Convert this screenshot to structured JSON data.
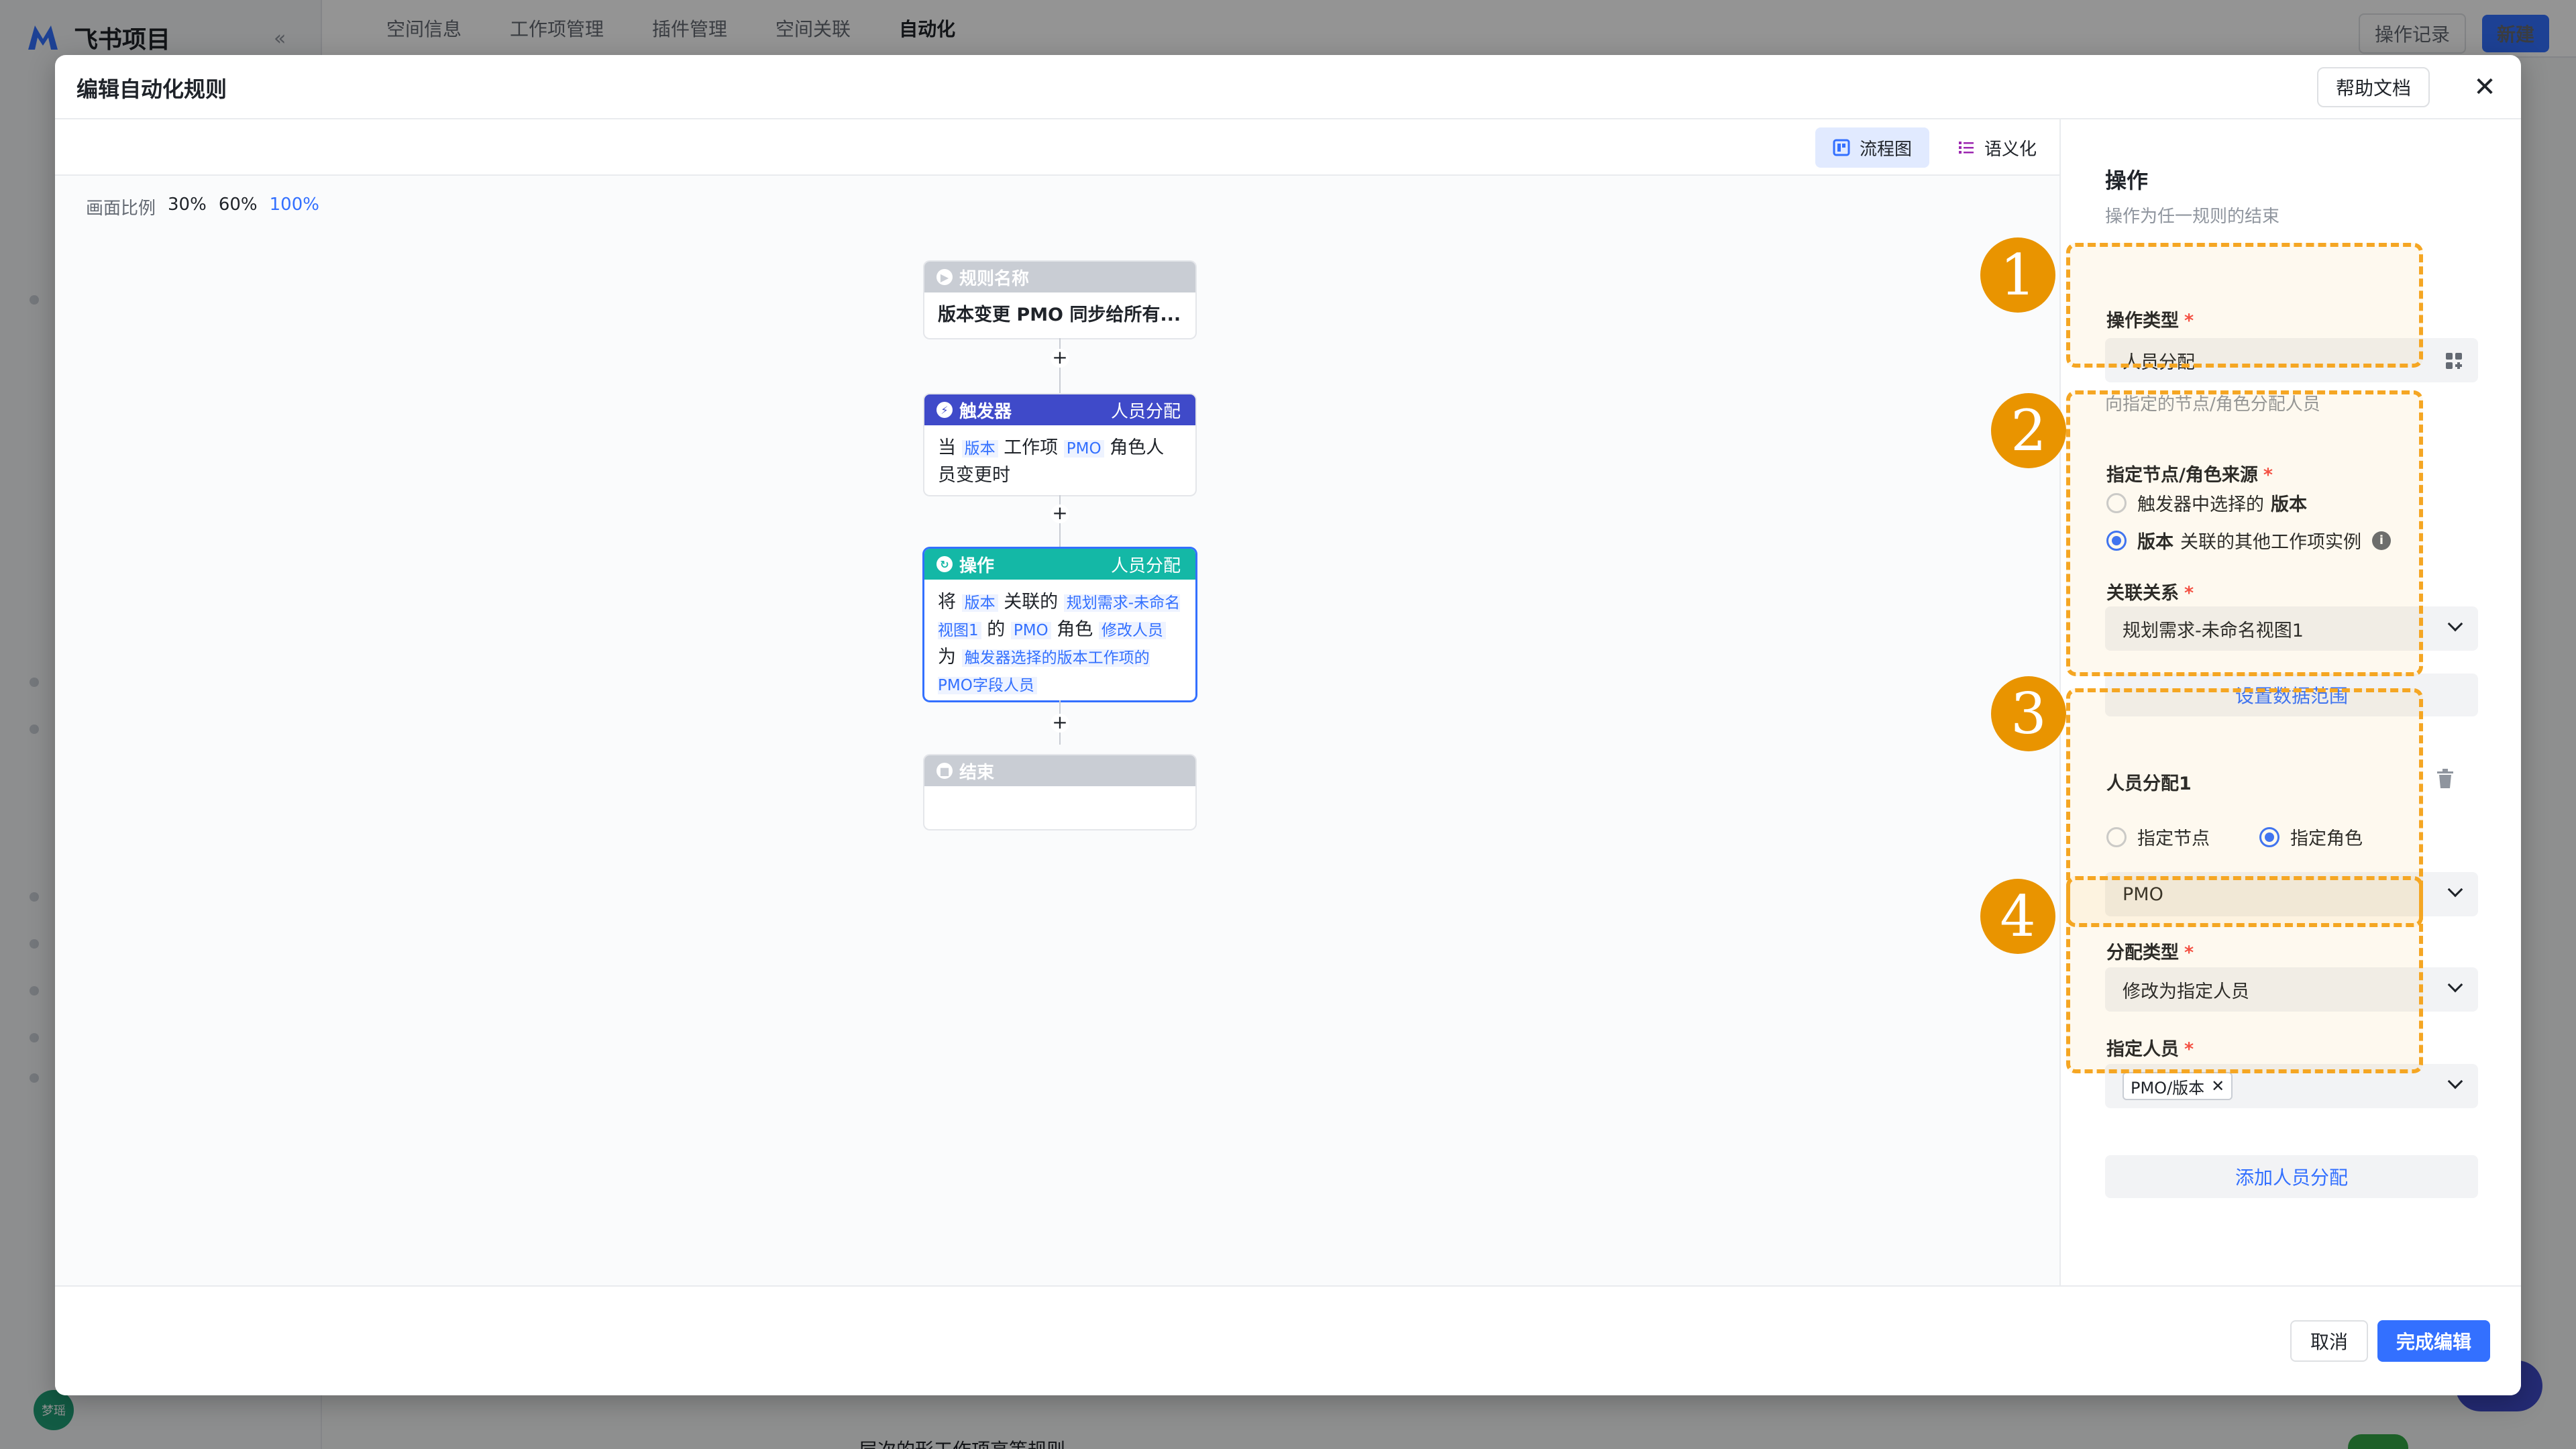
{
  "background": {
    "app_name": "飞书项目",
    "nav_tabs": [
      "空间信息",
      "工作项管理",
      "插件管理",
      "空间关联",
      "自动化"
    ],
    "oplog_label": "操作记录",
    "new_label": "新建",
    "avatar_text": "梦瑶",
    "bottom_text": "层次的形工作项高等规则"
  },
  "modal": {
    "title": "编辑自动化规则",
    "help_label": "帮助文档",
    "close_icon": "close-icon",
    "view_flow_label": "流程图",
    "view_semantic_label": "语义化",
    "zoom_label": "画面比例",
    "zoom_options": [
      "30%",
      "60%",
      "100%"
    ],
    "zoom_active": "100%"
  },
  "flow": {
    "rule_node": {
      "head": "规则名称",
      "body": "版本变更 PMO 同步给所有..."
    },
    "trigger_node": {
      "head": "触发器",
      "sub": "人员分配",
      "b1": "当",
      "t1": "版本",
      "b2": "工作项",
      "t2": "PMO",
      "b3": "角色人员变更时"
    },
    "action_node": {
      "head": "操作",
      "sub": "人员分配",
      "b1": "将",
      "t1": "版本",
      "b2": "关联的",
      "t2": "规划需求-未命名视图1",
      "b3": "的",
      "t3": "PMO",
      "b4": "角色",
      "t4": "修改人员",
      "b5": "为",
      "t5": "触发器选择的版本工作项的PMO字段人员"
    },
    "end_node": {
      "head": "结束"
    }
  },
  "panel": {
    "title": "操作",
    "desc": "操作为任一规则的结束",
    "op_type_label": "操作类型",
    "op_type_value": "人员分配",
    "op_type_hint": "向指定的节点/角色分配人员",
    "source_label": "指定节点/角色来源",
    "source_opt1_a": "触发器中选择的",
    "source_opt1_b": "版本",
    "source_opt2_a": "版本",
    "source_opt2_b": "关联的其他工作项实例",
    "relation_label": "关联关系",
    "relation_value": "规划需求-未命名视图1",
    "set_range_label": "设置数据范围",
    "assign_title": "人员分配1",
    "assign_opt_node": "指定节点",
    "assign_opt_role": "指定角色",
    "role_value": "PMO",
    "assign_type_label": "分配类型",
    "assign_type_value": "修改为指定人员",
    "person_label": "指定人员",
    "person_chip": "PMO/版本",
    "add_assign_label": "添加人员分配"
  },
  "badges": [
    "1",
    "2",
    "3",
    "4"
  ],
  "footer": {
    "cancel_label": "取消",
    "done_label": "完成编辑"
  },
  "colors": {
    "accent": "#3370ff",
    "annotation": "#f5a623",
    "trigger": "#3f4ac9",
    "action": "#14b8a6"
  }
}
